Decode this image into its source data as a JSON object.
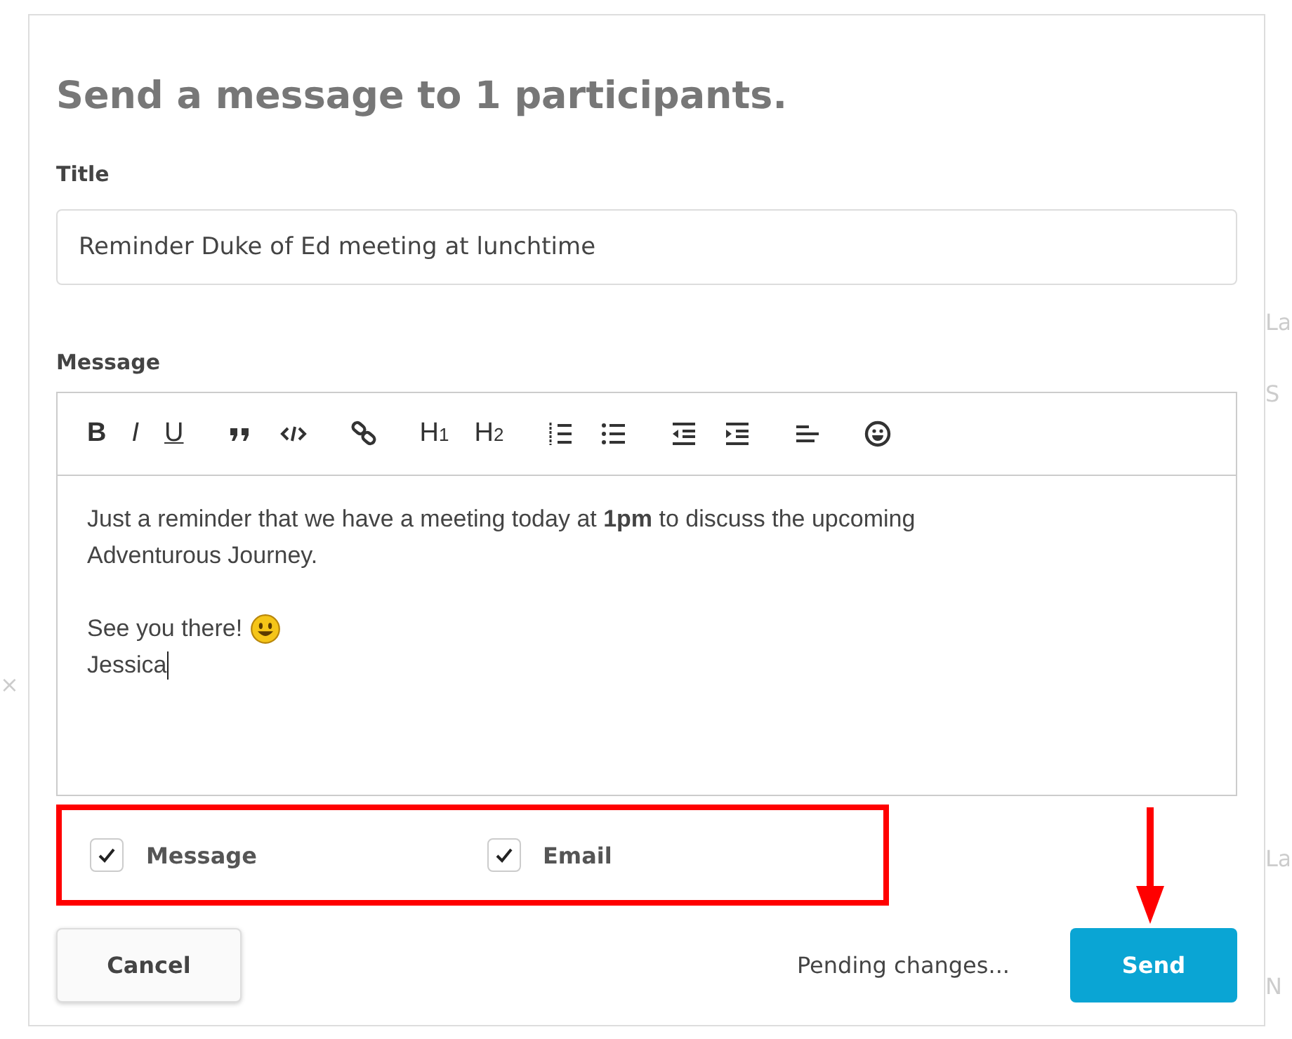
{
  "background": {
    "right_fragments": [
      "La",
      "S",
      "La",
      "N"
    ],
    "left_fragments": [
      "×"
    ]
  },
  "dialog": {
    "title": "Send a message to 1 participants.",
    "title_field": {
      "label": "Title",
      "value": "Reminder Duke of Ed meeting at lunchtime"
    },
    "message_label": "Message",
    "toolbar": [
      [
        {
          "kind": "bold",
          "label": "B"
        },
        {
          "kind": "italic",
          "label": "I"
        },
        {
          "kind": "underline",
          "label": "U"
        }
      ],
      [
        {
          "kind": "quote"
        },
        {
          "kind": "code"
        }
      ],
      [
        {
          "kind": "link"
        }
      ],
      [
        {
          "kind": "heading",
          "label": "H",
          "sub": "1"
        },
        {
          "kind": "heading",
          "label": "H",
          "sub": "2"
        }
      ],
      [
        {
          "kind": "ordered-list"
        },
        {
          "kind": "bullet-list"
        }
      ],
      [
        {
          "kind": "outdent"
        },
        {
          "kind": "indent"
        }
      ],
      [
        {
          "kind": "align"
        }
      ],
      [
        {
          "kind": "emoji"
        }
      ]
    ],
    "body": [
      {
        "kind": "text",
        "text": "Just a reminder that we have a meeting today at **1pm** to discuss the upcoming Adventurous Journey."
      },
      {
        "kind": "blank"
      },
      {
        "kind": "text",
        "text": "See you there!",
        "emoji": true
      },
      {
        "kind": "text",
        "text": "Jessica",
        "cursor": true
      }
    ],
    "channels": [
      {
        "label": "Message",
        "checked": true
      },
      {
        "label": "Email",
        "checked": true
      }
    ],
    "highlight": true,
    "cancel": "Cancel",
    "status": "Pending changes...",
    "send": "Send",
    "send_arrow": true
  }
}
